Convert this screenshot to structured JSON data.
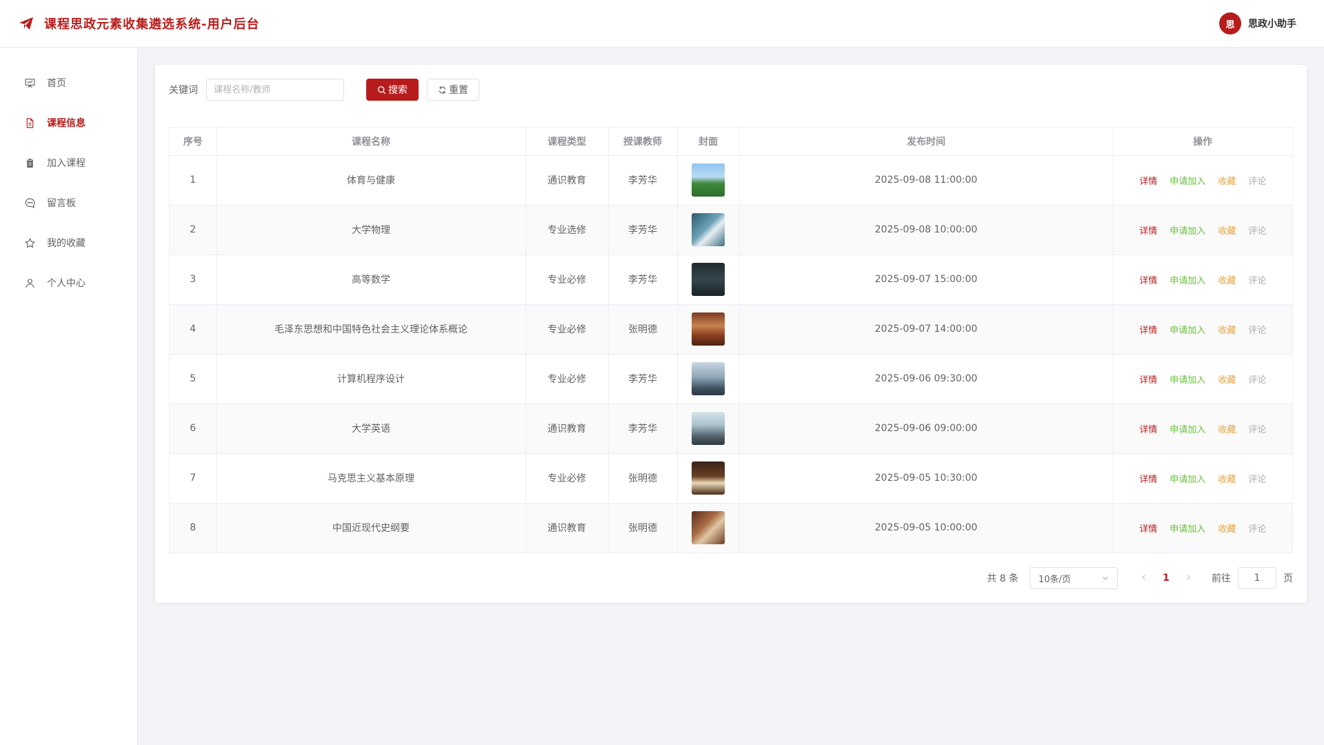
{
  "header": {
    "title": "课程思政元素收集遴选系统-用户后台",
    "user_avatar_text": "思",
    "user_name": "思政小助手"
  },
  "sidebar": {
    "items": [
      {
        "label": "首页",
        "icon": "presentation-icon",
        "active": false
      },
      {
        "label": "课程信息",
        "icon": "document-icon",
        "active": true
      },
      {
        "label": "加入课程",
        "icon": "clipboard-icon",
        "active": false
      },
      {
        "label": "留言板",
        "icon": "chat-icon",
        "active": false
      },
      {
        "label": "我的收藏",
        "icon": "star-icon",
        "active": false
      },
      {
        "label": "个人中心",
        "icon": "user-icon",
        "active": false
      }
    ]
  },
  "search": {
    "label": "关键词",
    "placeholder": "课程名称/教师",
    "value": "",
    "search_button": "搜索",
    "reset_button": "重置"
  },
  "table": {
    "columns": [
      "序号",
      "课程名称",
      "课程类型",
      "授课教师",
      "封面",
      "发布时间",
      "操作"
    ],
    "rows": [
      {
        "index": "1",
        "name": "体育与健康",
        "type": "通识教育",
        "teacher": "李芳华",
        "time": "2025-09-08 11:00:00"
      },
      {
        "index": "2",
        "name": "大学物理",
        "type": "专业选修",
        "teacher": "李芳华",
        "time": "2025-09-08 10:00:00"
      },
      {
        "index": "3",
        "name": "高等数学",
        "type": "专业必修",
        "teacher": "李芳华",
        "time": "2025-09-07 15:00:00"
      },
      {
        "index": "4",
        "name": "毛泽东思想和中国特色社会主义理论体系概论",
        "type": "专业必修",
        "teacher": "张明德",
        "time": "2025-09-07 14:00:00"
      },
      {
        "index": "5",
        "name": "计算机程序设计",
        "type": "专业必修",
        "teacher": "李芳华",
        "time": "2025-09-06 09:30:00"
      },
      {
        "index": "6",
        "name": "大学英语",
        "type": "通识教育",
        "teacher": "李芳华",
        "time": "2025-09-06 09:00:00"
      },
      {
        "index": "7",
        "name": "马克思主义基本原理",
        "type": "专业必修",
        "teacher": "张明德",
        "time": "2025-09-05 10:30:00"
      },
      {
        "index": "8",
        "name": "中国近现代史纲要",
        "type": "通识教育",
        "teacher": "张明德",
        "time": "2025-09-05 10:00:00"
      }
    ],
    "actions": {
      "detail": "详情",
      "join": "申请加入",
      "favorite": "收藏",
      "comment": "评论"
    }
  },
  "pagination": {
    "total": "共 8 条",
    "page_size": "10条/页",
    "current_page": "1",
    "goto_label": "前往",
    "goto_value": "1",
    "page_unit": "页"
  },
  "colors": {
    "accent": "#b71c1c",
    "join": "#67c23a",
    "favorite": "#e6a23c",
    "comment": "#a8abb2"
  }
}
